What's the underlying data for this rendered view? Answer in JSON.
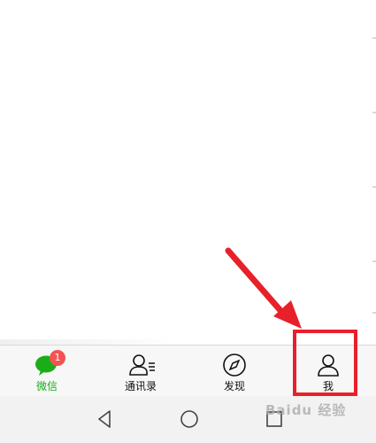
{
  "tabs": [
    {
      "id": "chats",
      "label": "微信",
      "icon": "chat-bubble-icon",
      "badge": "1",
      "active": true
    },
    {
      "id": "contacts",
      "label": "通讯录",
      "icon": "contacts-icon"
    },
    {
      "id": "discover",
      "label": "发现",
      "icon": "compass-icon"
    },
    {
      "id": "me",
      "label": "我",
      "icon": "person-icon"
    }
  ],
  "system_nav": [
    "back-icon",
    "home-icon",
    "recents-icon"
  ],
  "watermark": "Baidu 经验",
  "colors": {
    "active": "#1aad19",
    "badge": "#f35352",
    "annotation": "#e8202a"
  }
}
